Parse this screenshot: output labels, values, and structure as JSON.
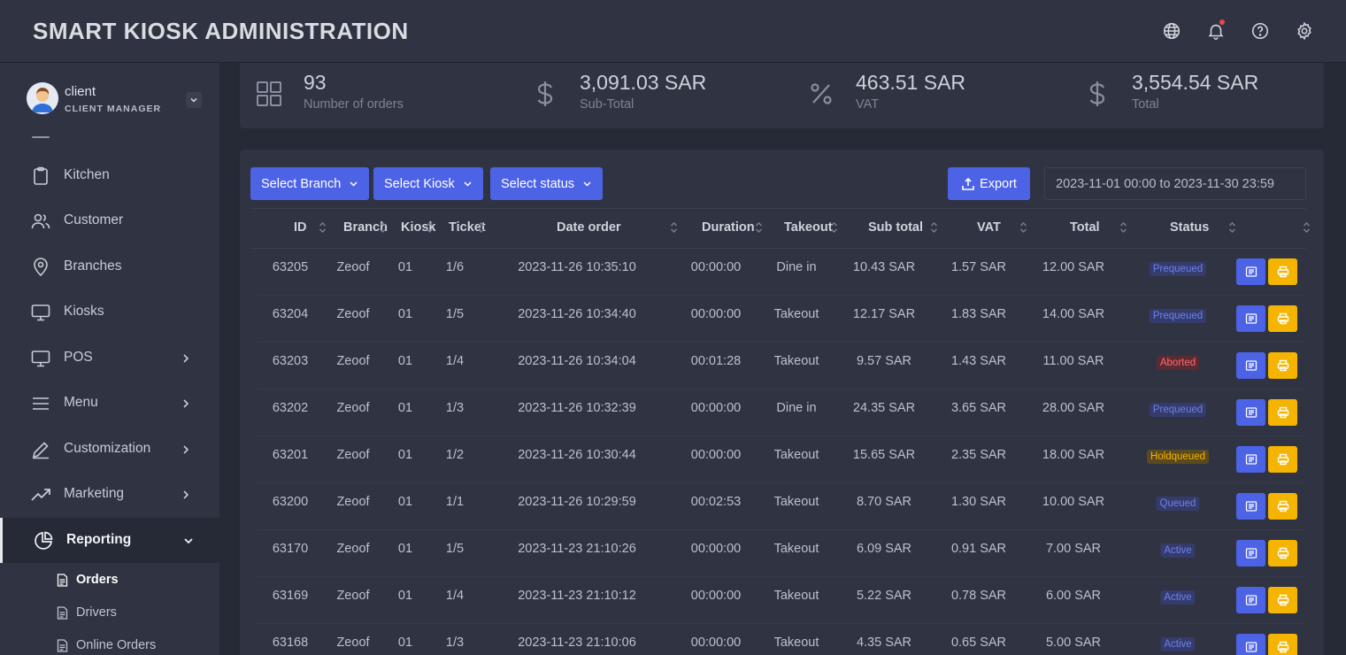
{
  "app": {
    "title": "SMART KIOSK ADMINISTRATION"
  },
  "header_icons": [
    "globe-icon",
    "bell-icon",
    "help-icon",
    "gear-icon"
  ],
  "user": {
    "name": "client",
    "role": "CLIENT MANAGER"
  },
  "sidebar": {
    "items": [
      {
        "label": "Kitchen",
        "icon": "clipboard-icon",
        "has_children": false
      },
      {
        "label": "Customer",
        "icon": "users-icon",
        "has_children": false
      },
      {
        "label": "Branches",
        "icon": "map-pin-icon",
        "has_children": false
      },
      {
        "label": "Kiosks",
        "icon": "monitor-icon",
        "has_children": false
      },
      {
        "label": "POS",
        "icon": "monitor-icon",
        "has_children": true
      },
      {
        "label": "Menu",
        "icon": "menu-lines-icon",
        "has_children": true
      },
      {
        "label": "Customization",
        "icon": "pen-icon",
        "has_children": true
      },
      {
        "label": "Marketing",
        "icon": "trend-icon",
        "has_children": true
      },
      {
        "label": "Reporting",
        "icon": "pie-chart-icon",
        "has_children": true,
        "expanded": true
      }
    ],
    "sub_items": [
      {
        "label": "Orders",
        "current": true
      },
      {
        "label": "Drivers",
        "current": false
      },
      {
        "label": "Online Orders",
        "current": false
      }
    ]
  },
  "stats": [
    {
      "value": "93",
      "label": "Number of orders",
      "icon": "grid-icon"
    },
    {
      "value": "3,091.03 SAR",
      "label": "Sub-Total",
      "icon": "dollar-icon"
    },
    {
      "value": "463.51 SAR",
      "label": "VAT",
      "icon": "percent-icon"
    },
    {
      "value": "3,554.54 SAR",
      "label": "Total",
      "icon": "dollar-icon"
    }
  ],
  "filters": {
    "branch": "Select Branch",
    "kiosk": "Select Kiosk",
    "status": "Select status",
    "export": "Export",
    "date_range": "2023-11-01 00:00 to 2023-11-30 23:59"
  },
  "table": {
    "headers": [
      "ID",
      "Branch",
      "Kiosk",
      "Ticket",
      "Date order",
      "Duration",
      "Takeout",
      "Sub total",
      "VAT",
      "Total",
      "Status"
    ],
    "rows": [
      [
        "63205",
        "Zeoof",
        "01",
        "1/6",
        "2023-11-26 10:35:10",
        "00:00:00",
        "Dine in",
        "10.43 SAR",
        "1.57 SAR",
        "12.00 SAR",
        "Prequeued"
      ],
      [
        "63204",
        "Zeoof",
        "01",
        "1/5",
        "2023-11-26 10:34:40",
        "00:00:00",
        "Takeout",
        "12.17 SAR",
        "1.83 SAR",
        "14.00 SAR",
        "Prequeued"
      ],
      [
        "63203",
        "Zeoof",
        "01",
        "1/4",
        "2023-11-26 10:34:04",
        "00:01:28",
        "Takeout",
        "9.57 SAR",
        "1.43 SAR",
        "11.00 SAR",
        "Aborted"
      ],
      [
        "63202",
        "Zeoof",
        "01",
        "1/3",
        "2023-11-26 10:32:39",
        "00:00:00",
        "Dine in",
        "24.35 SAR",
        "3.65 SAR",
        "28.00 SAR",
        "Prequeued"
      ],
      [
        "63201",
        "Zeoof",
        "01",
        "1/2",
        "2023-11-26 10:30:44",
        "00:00:00",
        "Takeout",
        "15.65 SAR",
        "2.35 SAR",
        "18.00 SAR",
        "Holdqueued"
      ],
      [
        "63200",
        "Zeoof",
        "01",
        "1/1",
        "2023-11-26 10:29:59",
        "00:02:53",
        "Takeout",
        "8.70 SAR",
        "1.30 SAR",
        "10.00 SAR",
        "Queued"
      ],
      [
        "63170",
        "Zeoof",
        "01",
        "1/5",
        "2023-11-23 21:10:26",
        "00:00:00",
        "Takeout",
        "6.09 SAR",
        "0.91 SAR",
        "7.00 SAR",
        "Active"
      ],
      [
        "63169",
        "Zeoof",
        "01",
        "1/4",
        "2023-11-23 21:10:12",
        "00:00:00",
        "Takeout",
        "5.22 SAR",
        "0.78 SAR",
        "6.00 SAR",
        "Active"
      ],
      [
        "63168",
        "Zeoof",
        "01",
        "1/3",
        "2023-11-23 21:10:06",
        "00:00:00",
        "Takeout",
        "4.35 SAR",
        "0.65 SAR",
        "5.00 SAR",
        "Active"
      ]
    ],
    "row_actions": [
      "view-icon",
      "print-icon"
    ]
  },
  "colors": {
    "accent": "#4d63e6",
    "print": "#f5b400",
    "status": {
      "Prequeued": {
        "fg": "#6d80f0",
        "bg": "#353c6b"
      },
      "Aborted": {
        "fg": "#ff6b6b",
        "bg": "#5b2a33"
      },
      "Holdqueued": {
        "fg": "#f5b400",
        "bg": "#5a4a1f"
      },
      "Queued": {
        "fg": "#6d80f0",
        "bg": "#353c6b"
      },
      "Active": {
        "fg": "#6d80f0",
        "bg": "#353c6b"
      }
    }
  }
}
